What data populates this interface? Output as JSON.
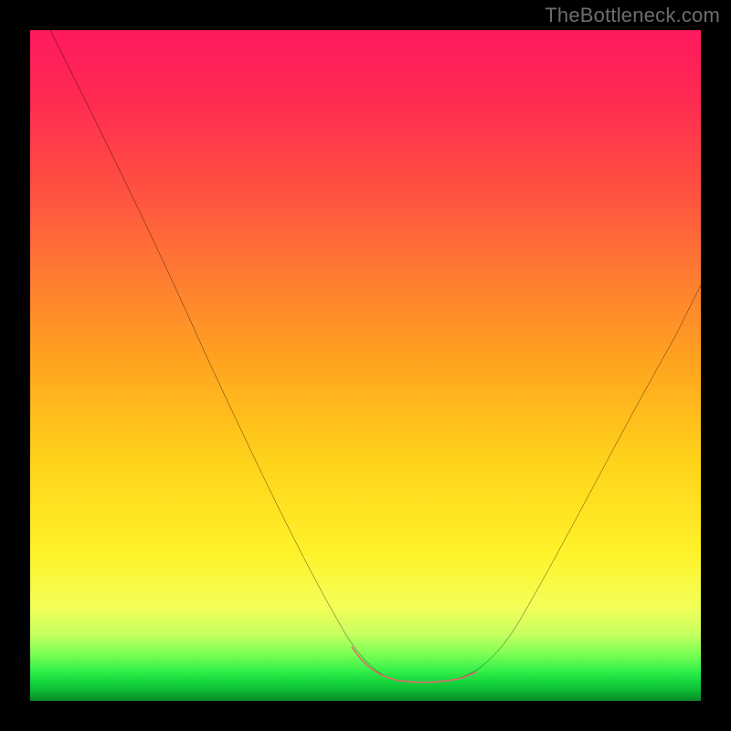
{
  "watermark": {
    "text": "TheBottleneck.com"
  },
  "colors": {
    "frame": "#000000",
    "curve_main": "#000000",
    "curve_base": "#e36a6a",
    "gradient_top": "#ff1a5e",
    "gradient_bottom": "#078a27"
  },
  "chart_data": {
    "type": "line",
    "title": "",
    "xlabel": "",
    "ylabel": "",
    "xlim": [
      0,
      100
    ],
    "ylim": [
      0,
      100
    ],
    "grid": false,
    "note": "Axes carry no tick labels in the image; values are relative percentages of the plot area. y=100 is the curve touching the bottom (green) edge; y=0 is the top (red) edge. Curve resembles a bottleneck/valley with a flat bottom and a small highlighted base segment.",
    "series": [
      {
        "name": "bottleneck-curve",
        "x": [
          3,
          8,
          14,
          20,
          26,
          32,
          38,
          44,
          48,
          52,
          55,
          58,
          62,
          66,
          72,
          80,
          88,
          96,
          100
        ],
        "y": [
          0,
          12,
          24,
          36,
          48,
          60,
          72,
          84,
          92,
          96,
          97,
          97,
          97,
          96,
          90,
          78,
          62,
          46,
          38
        ]
      },
      {
        "name": "base-highlight",
        "x": [
          48,
          52,
          55,
          58,
          62,
          66
        ],
        "y": [
          92,
          96,
          97,
          97,
          97,
          96
        ]
      }
    ]
  }
}
